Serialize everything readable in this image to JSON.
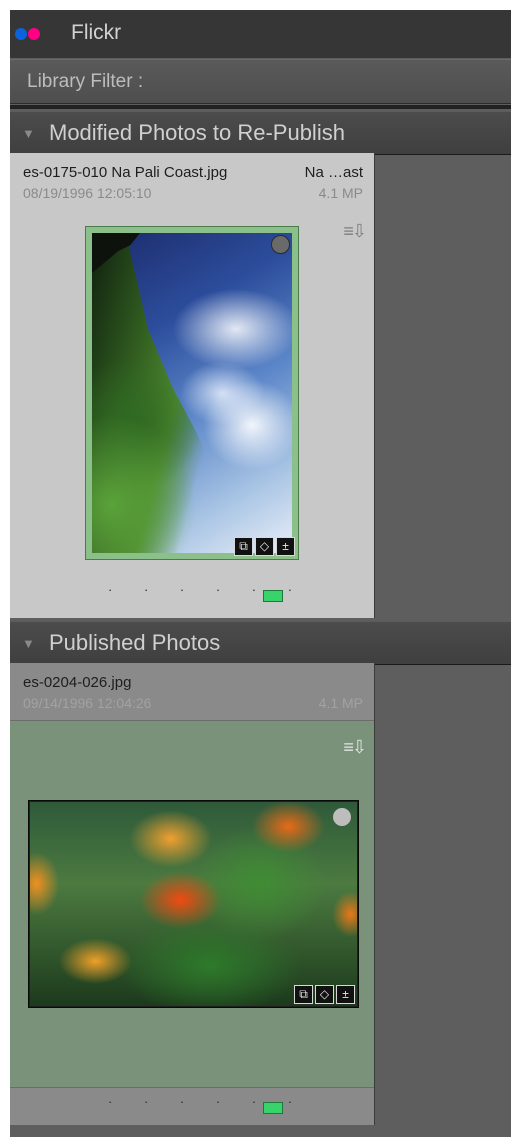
{
  "panel": {
    "title": "Flickr",
    "logo_colors": [
      "#0a63dc",
      "#ff0084"
    ],
    "filter_label": "Library Filter :"
  },
  "sections": [
    {
      "title": "Modified Photos to Re-Publish",
      "photo": {
        "filename": "es-0175-010 Na Pali Coast.jpg",
        "title": "Na …ast",
        "date": "08/19/1996 12:05:10",
        "megapixels": "4.1 MP",
        "rating_dots": "· · · · · ·",
        "color_label": "green"
      }
    },
    {
      "title": "Published Photos",
      "photo": {
        "filename": "es-0204-026.jpg",
        "date": "09/14/1996 12:04:26",
        "megapixels": "4.1 MP",
        "rating_dots": "· · · · · ·",
        "color_label": "green"
      }
    }
  ],
  "icons": {
    "metadata": "≡⇩",
    "badges": [
      "⧉",
      "◇",
      "±"
    ]
  }
}
